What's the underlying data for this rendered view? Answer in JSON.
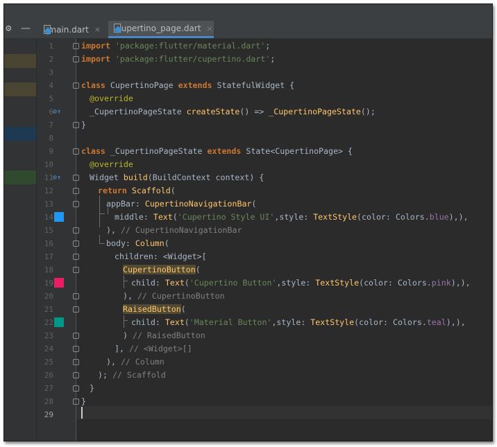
{
  "tabs": [
    {
      "label": "main.dart",
      "active": false
    },
    {
      "label": "cupertino_page.dart",
      "active": true
    }
  ],
  "close_glyph": "×",
  "toolbar": {
    "gear_glyph": "⚙",
    "minimize_glyph": "—"
  },
  "line_numbers": [
    "1",
    "2",
    "3",
    "4",
    "5",
    "6",
    "7",
    "8",
    "9",
    "10",
    "11",
    "12",
    "13",
    "14",
    "15",
    "16",
    "17",
    "18",
    "19",
    "20",
    "21",
    "22",
    "23",
    "24",
    "25",
    "26",
    "27",
    "28",
    "29"
  ],
  "code": {
    "l1": {
      "kw": "import",
      "str": " 'package:flutter/material.dart'",
      "rest": ";"
    },
    "l2": {
      "kw": "import",
      "str": " 'package:flutter/cupertino.dart'",
      "rest": ";"
    },
    "l4": {
      "kw": "class",
      "a": " CupertinoPage ",
      "kw2": "extends",
      "b": " StatefulWidget {"
    },
    "l5": {
      "ann": "@override"
    },
    "l6": {
      "a": "_CupertinoPageState ",
      "fn": "createState",
      "b": "() => ",
      "fn2": "_CupertinoPageState",
      "c": "();"
    },
    "l7": {
      "a": "}"
    },
    "l9": {
      "kw": "class",
      "a": " _CupertinoPageState ",
      "kw2": "extends",
      "b": " State<CupertinoPage> {"
    },
    "l10": {
      "ann": "@override"
    },
    "l11": {
      "a": "Widget ",
      "fn": "build",
      "b": "(BuildContext context) {"
    },
    "l12": {
      "kw": "return",
      "fn": " Scaffold",
      "b": "("
    },
    "l13": {
      "a": "appBar: ",
      "fn": "CupertinoNavigationBar",
      "b": "("
    },
    "l14": {
      "a": "middle: ",
      "fn": "Text",
      "b": "(",
      "str": "'Cupertino Style UI'",
      "c": ",style: ",
      "fn2": "TextStyle",
      "d": "(color: Colors.",
      "prop": "blue",
      "e": "),),"
    },
    "l15": {
      "a": "), ",
      "cmt": "// CupertinoNavigationBar"
    },
    "l16": {
      "a": "body: ",
      "fn": "Column",
      "b": "("
    },
    "l17": {
      "a": "children: <Widget>["
    },
    "l18": {
      "fn": "CupertinoButton",
      "b": "("
    },
    "l19": {
      "a": "child: ",
      "fn": "Text",
      "b": "(",
      "str": "'Cupertino Button'",
      "c": ",style: ",
      "fn2": "TextStyle",
      "d": "(color: Colors.",
      "prop": "pink",
      "e": "),),"
    },
    "l20": {
      "a": "), ",
      "cmt": "// CupertinoButton"
    },
    "l21": {
      "fn": "RaisedButton",
      "b": "("
    },
    "l22": {
      "a": "child: ",
      "fn": "Text",
      "b": "(",
      "str": "'Material Button'",
      "c": ",style: ",
      "fn2": "TextStyle",
      "d": "(color: Colors.",
      "prop": "teal",
      "e": "),),"
    },
    "l23": {
      "a": ") ",
      "cmt": "// RaisedButton"
    },
    "l24": {
      "a": "], ",
      "cmt": "// <Widget>[]"
    },
    "l25": {
      "a": "), ",
      "cmt": "// Column"
    },
    "l26": {
      "a": "); ",
      "cmt": "// Scaffold"
    },
    "l27": {
      "a": "}"
    },
    "l28": {
      "a": "}"
    }
  },
  "swatch_colors": {
    "blue": "#2196f3",
    "pink": "#e91e63",
    "teal": "#009688"
  },
  "gutter_icons": {
    "override": "override-icon"
  }
}
